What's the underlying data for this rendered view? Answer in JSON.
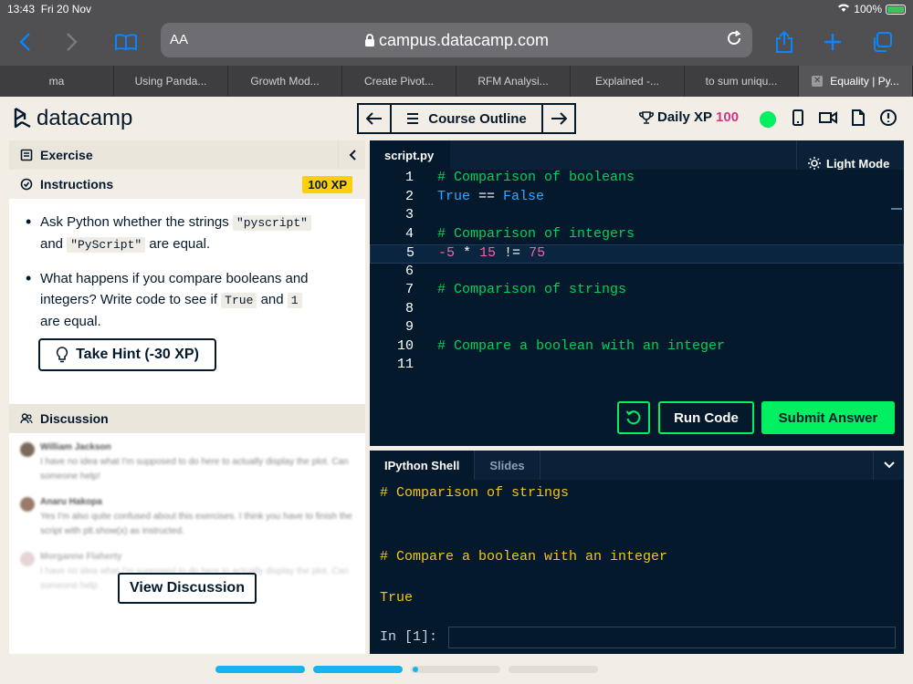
{
  "status_bar": {
    "time": "13:43",
    "date": "Fri 20 Nov",
    "battery": "100%"
  },
  "browser": {
    "text_size_label": "AA",
    "url": "campus.datacamp.com",
    "tabs": [
      {
        "label": "ma",
        "active": false
      },
      {
        "label": "Using Panda...",
        "active": false
      },
      {
        "label": "Growth Mod...",
        "active": false
      },
      {
        "label": "Create Pivot...",
        "active": false
      },
      {
        "label": "RFM Analysi...",
        "active": false
      },
      {
        "label": "Explained -...",
        "active": false
      },
      {
        "label": "to sum uniqu...",
        "active": false
      },
      {
        "label": "Equality | Py...",
        "active": true
      }
    ]
  },
  "header": {
    "logo_text": "datacamp",
    "course_outline_label": "Course Outline",
    "daily_xp_label": "Daily XP",
    "daily_xp_value": "100"
  },
  "exercise": {
    "section_label": "Exercise",
    "instructions_label": "Instructions",
    "xp_badge": "100 XP",
    "instruction_1": {
      "pre": "Ask Python whether the strings",
      "code1": "\"pyscript\"",
      "mid": "and",
      "code2": "\"PyScript\"",
      "post": "are equal."
    },
    "instruction_2": {
      "pre": "What happens if you compare booleans and integers? Write code to see if",
      "code1": "True",
      "mid": "and",
      "code2": "1",
      "post": "are equal."
    },
    "hint_label": "Take Hint (-30 XP)"
  },
  "discussion": {
    "section_label": "Discussion",
    "posts": [
      {
        "author": "William Jackson",
        "text": "I have no idea what I'm supposed to do here to actually display the plot. Can someone help!"
      },
      {
        "author": "Anaru Hakopa",
        "text": "Yes I'm also quite confused about this exercises. I think you have to finish the script with plt.show(x) as instructed."
      },
      {
        "author": "Morganne Flaherty",
        "text": "I have no idea what I'm supposed to do here to actually display the plot. Can someone help"
      }
    ],
    "view_label": "View Discussion"
  },
  "editor": {
    "file_tab": "script.py",
    "light_mode_label": "Light Mode",
    "line_numbers": [
      "1",
      "2",
      "3",
      "4",
      "5",
      "6",
      "7",
      "8",
      "9",
      "10",
      "11"
    ],
    "code": {
      "l1": "# Comparison of booleans",
      "l2_a": "True",
      "l2_op": " == ",
      "l2_b": "False",
      "l4": "# Comparison of integers",
      "l5_a": "-5",
      "l5_op1": " * ",
      "l5_b": "15",
      "l5_op2": " != ",
      "l5_c": "75",
      "l7": "# Comparison of strings",
      "l10": "# Compare a boolean with an integer"
    },
    "run_label": "Run Code",
    "submit_label": "Submit Answer"
  },
  "shell": {
    "tabs": [
      "IPython Shell",
      "Slides"
    ],
    "lines": [
      "# Comparison of strings",
      "# Compare a boolean with an integer",
      "True"
    ],
    "prompt": "In [1]:"
  },
  "colors": {
    "brand_green": "#03ef62",
    "navy": "#05192d",
    "xp_badge": "#fcce0d",
    "progress": "#1ab2ec"
  },
  "progress": {
    "segments_done": 2,
    "segments_total": 6
  }
}
